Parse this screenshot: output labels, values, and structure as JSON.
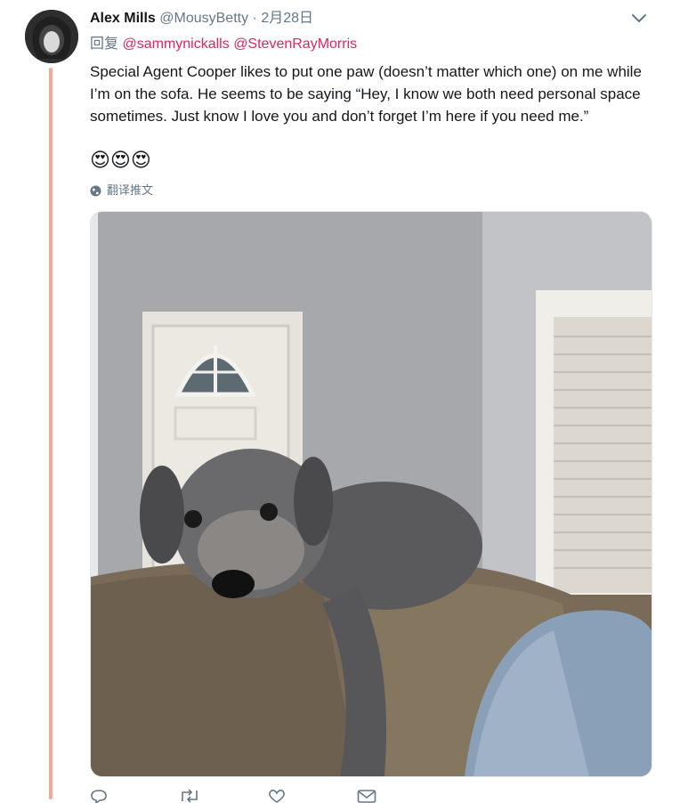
{
  "tweet": {
    "author_name": "Alex Mills",
    "author_handle": "@MousyBetty",
    "separator": "·",
    "date": "2月28日",
    "reply_prefix": "回复",
    "reply_to": [
      "@sammynickalls",
      "@StevenRayMorris"
    ],
    "text": "Special Agent Cooper likes to put one paw (doesn’t matter which one) on me while I’m on the sofa. He seems to be saying “Hey, I know we both need personal space sometimes. Just know I love you and don’t forget I’m here if you need me.”",
    "emojis": "😍😍😍",
    "translate_label": "翻译推文"
  },
  "colors": {
    "thread_line": "#f5a899",
    "mention": "#e0245e",
    "muted": "#657786"
  },
  "icons": {
    "chevron": "chevron-down-icon",
    "globe": "globe-icon",
    "reply": "reply-icon",
    "retweet": "retweet-icon",
    "like": "heart-icon",
    "dm": "envelope-icon"
  }
}
